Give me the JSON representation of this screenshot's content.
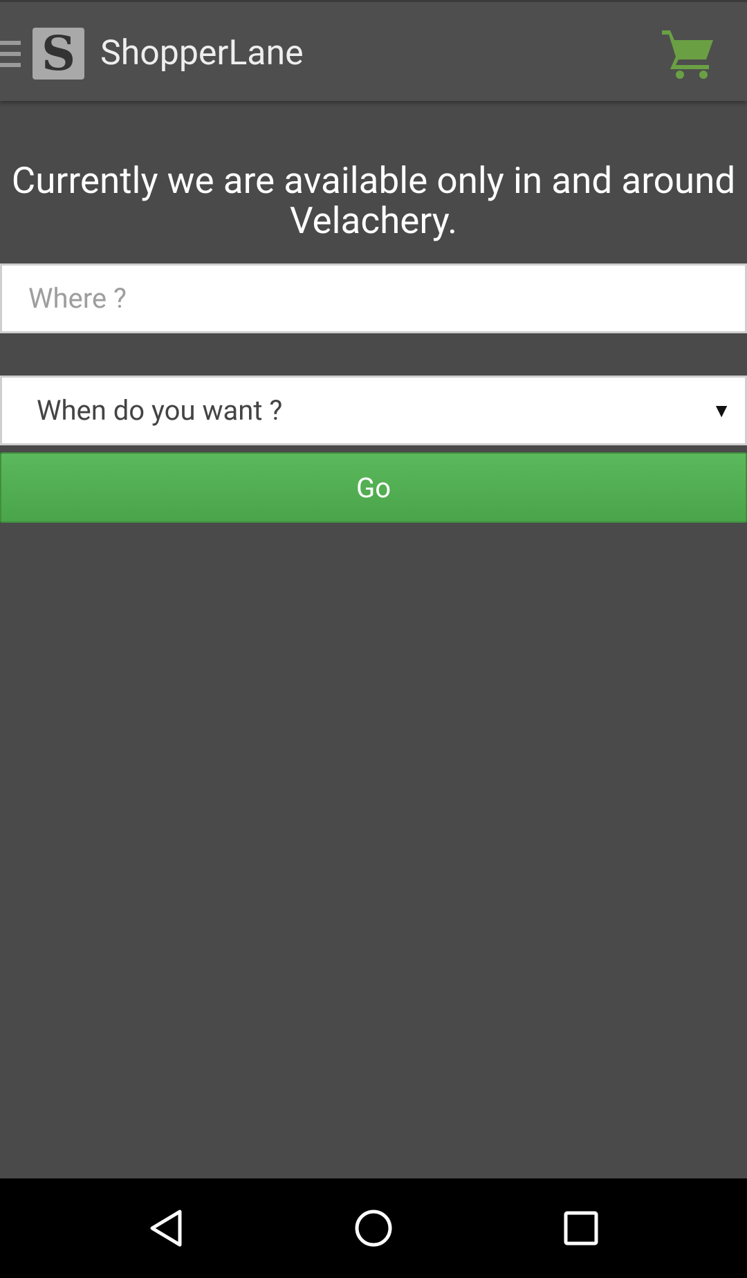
{
  "topbar": {
    "menu_icon": "menu-icon",
    "logo_letter": "S",
    "title": "ShopperLane",
    "cart_icon": "shopping-cart-icon",
    "cart_color": "#6aa043"
  },
  "main": {
    "notice_line1": "Currently we are available only in and around",
    "notice_line2": "Velachery.",
    "where_placeholder": "Where ?",
    "when_selected": "When do you want ?",
    "go_label": "Go"
  },
  "navbar": {
    "back_icon": "back-icon",
    "home_icon": "home-icon",
    "recents_icon": "recents-icon"
  }
}
